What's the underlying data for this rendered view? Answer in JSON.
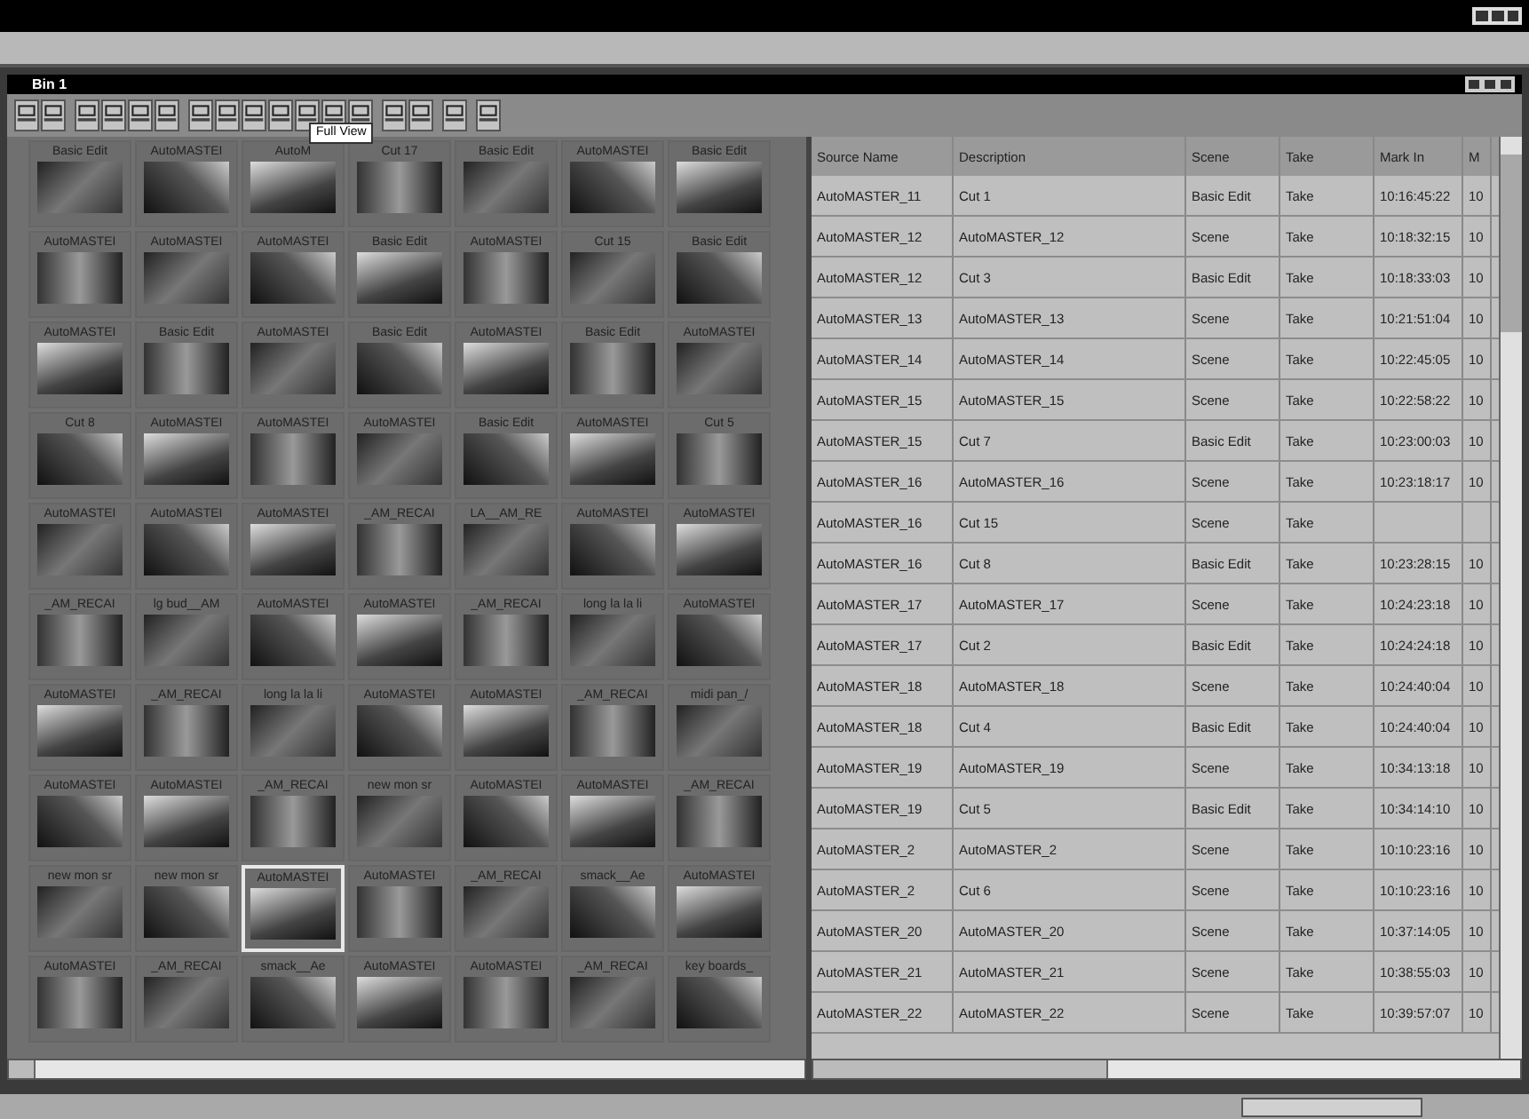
{
  "bin_window": {
    "title": "Bin 1"
  },
  "toolbar": {
    "tooltip": "Full View"
  },
  "frames": [
    [
      {
        "label": "Basic Edit",
        "selected": false
      },
      {
        "label": "AutoMASTEI",
        "selected": false
      },
      {
        "label": "AutoM",
        "selected": false
      },
      {
        "label": "Cut 17",
        "selected": false
      },
      {
        "label": "Basic Edit",
        "selected": false
      },
      {
        "label": "AutoMASTEI",
        "selected": false
      },
      {
        "label": "Basic Edit",
        "selected": false
      }
    ],
    [
      {
        "label": "AutoMASTEI",
        "selected": false
      },
      {
        "label": "AutoMASTEI",
        "selected": false
      },
      {
        "label": "AutoMASTEI",
        "selected": false
      },
      {
        "label": "Basic Edit",
        "selected": false
      },
      {
        "label": "AutoMASTEI",
        "selected": false
      },
      {
        "label": "Cut 15",
        "selected": false
      },
      {
        "label": "Basic Edit",
        "selected": false
      }
    ],
    [
      {
        "label": "AutoMASTEI",
        "selected": false
      },
      {
        "label": "Basic Edit",
        "selected": false
      },
      {
        "label": "AutoMASTEI",
        "selected": false
      },
      {
        "label": "Basic Edit",
        "selected": false
      },
      {
        "label": "AutoMASTEI",
        "selected": false
      },
      {
        "label": "Basic Edit",
        "selected": false
      },
      {
        "label": "AutoMASTEI",
        "selected": false
      }
    ],
    [
      {
        "label": "Cut 8",
        "selected": false
      },
      {
        "label": "AutoMASTEI",
        "selected": false
      },
      {
        "label": "AutoMASTEI",
        "selected": false
      },
      {
        "label": "AutoMASTEI",
        "selected": false
      },
      {
        "label": "Basic Edit",
        "selected": false
      },
      {
        "label": "AutoMASTEI",
        "selected": false
      },
      {
        "label": "Cut 5",
        "selected": false
      }
    ],
    [
      {
        "label": "AutoMASTEI",
        "selected": false
      },
      {
        "label": "AutoMASTEI",
        "selected": false
      },
      {
        "label": "AutoMASTEI",
        "selected": false
      },
      {
        "label": "_AM_RECAI",
        "selected": false
      },
      {
        "label": "LA__AM_RE",
        "selected": false
      },
      {
        "label": "AutoMASTEI",
        "selected": false
      },
      {
        "label": "AutoMASTEI",
        "selected": false
      }
    ],
    [
      {
        "label": "_AM_RECAI",
        "selected": false
      },
      {
        "label": "lg bud__AM",
        "selected": false
      },
      {
        "label": "AutoMASTEI",
        "selected": false
      },
      {
        "label": "AutoMASTEI",
        "selected": false
      },
      {
        "label": "_AM_RECAI",
        "selected": false
      },
      {
        "label": "long la la li",
        "selected": false
      },
      {
        "label": "AutoMASTEI",
        "selected": false
      }
    ],
    [
      {
        "label": "AutoMASTEI",
        "selected": false
      },
      {
        "label": "_AM_RECAI",
        "selected": false
      },
      {
        "label": "long la la li",
        "selected": false
      },
      {
        "label": "AutoMASTEI",
        "selected": false
      },
      {
        "label": "AutoMASTEI",
        "selected": false
      },
      {
        "label": "_AM_RECAI",
        "selected": false
      },
      {
        "label": "midi pan_/",
        "selected": false
      }
    ],
    [
      {
        "label": "AutoMASTEI",
        "selected": false
      },
      {
        "label": "AutoMASTEI",
        "selected": false
      },
      {
        "label": "_AM_RECAI",
        "selected": false
      },
      {
        "label": "new mon sr",
        "selected": false
      },
      {
        "label": "AutoMASTEI",
        "selected": false
      },
      {
        "label": "AutoMASTEI",
        "selected": false
      },
      {
        "label": "_AM_RECAI",
        "selected": false
      }
    ],
    [
      {
        "label": "new mon sr",
        "selected": false
      },
      {
        "label": "new mon sr",
        "selected": false
      },
      {
        "label": "AutoMASTEI",
        "selected": true
      },
      {
        "label": "AutoMASTEI",
        "selected": false
      },
      {
        "label": "_AM_RECAI",
        "selected": false
      },
      {
        "label": "smack__Ae",
        "selected": false
      },
      {
        "label": "AutoMASTEI",
        "selected": false
      }
    ],
    [
      {
        "label": "AutoMASTEI",
        "selected": false
      },
      {
        "label": "_AM_RECAI",
        "selected": false
      },
      {
        "label": "smack__Ae",
        "selected": false
      },
      {
        "label": "AutoMASTEI",
        "selected": false
      },
      {
        "label": "AutoMASTEI",
        "selected": false
      },
      {
        "label": "_AM_RECAI",
        "selected": false
      },
      {
        "label": "key boards_",
        "selected": false
      }
    ]
  ],
  "table": {
    "columns": [
      "Source Name",
      "Description",
      "Scene",
      "Take",
      "Mark In",
      "M"
    ],
    "rows": [
      [
        "AutoMASTER_11",
        "Cut 1",
        "Basic Edit",
        "Take",
        "10:16:45:22",
        "10"
      ],
      [
        "AutoMASTER_12",
        "AutoMASTER_12",
        "Scene",
        "Take",
        "10:18:32:15",
        "10"
      ],
      [
        "AutoMASTER_12",
        "Cut 3",
        "Basic Edit",
        "Take",
        "10:18:33:03",
        "10"
      ],
      [
        "AutoMASTER_13",
        "AutoMASTER_13",
        "Scene",
        "Take",
        "10:21:51:04",
        "10"
      ],
      [
        "AutoMASTER_14",
        "AutoMASTER_14",
        "Scene",
        "Take",
        "10:22:45:05",
        "10"
      ],
      [
        "AutoMASTER_15",
        "AutoMASTER_15",
        "Scene",
        "Take",
        "10:22:58:22",
        "10"
      ],
      [
        "AutoMASTER_15",
        "Cut 7",
        "Basic Edit",
        "Take",
        "10:23:00:03",
        "10"
      ],
      [
        "AutoMASTER_16",
        "AutoMASTER_16",
        "Scene",
        "Take",
        "10:23:18:17",
        "10"
      ],
      [
        "AutoMASTER_16",
        "Cut 15",
        "Scene",
        "Take",
        "",
        ""
      ],
      [
        "AutoMASTER_16",
        "Cut 8",
        "Basic Edit",
        "Take",
        "10:23:28:15",
        "10"
      ],
      [
        "AutoMASTER_17",
        "AutoMASTER_17",
        "Scene",
        "Take",
        "10:24:23:18",
        "10"
      ],
      [
        "AutoMASTER_17",
        "Cut 2",
        "Basic Edit",
        "Take",
        "10:24:24:18",
        "10"
      ],
      [
        "AutoMASTER_18",
        "AutoMASTER_18",
        "Scene",
        "Take",
        "10:24:40:04",
        "10"
      ],
      [
        "AutoMASTER_18",
        "Cut 4",
        "Basic Edit",
        "Take",
        "10:24:40:04",
        "10"
      ],
      [
        "AutoMASTER_19",
        "AutoMASTER_19",
        "Scene",
        "Take",
        "10:34:13:18",
        "10"
      ],
      [
        "AutoMASTER_19",
        "Cut 5",
        "Basic Edit",
        "Take",
        "10:34:14:10",
        "10"
      ],
      [
        "AutoMASTER_2",
        "AutoMASTER_2",
        "Scene",
        "Take",
        "10:10:23:16",
        "10"
      ],
      [
        "AutoMASTER_2",
        "Cut 6",
        "Scene",
        "Take",
        "10:10:23:16",
        "10"
      ],
      [
        "AutoMASTER_20",
        "AutoMASTER_20",
        "Scene",
        "Take",
        "10:37:14:05",
        "10"
      ],
      [
        "AutoMASTER_21",
        "AutoMASTER_21",
        "Scene",
        "Take",
        "10:38:55:03",
        "10"
      ],
      [
        "AutoMASTER_22",
        "AutoMASTER_22",
        "Scene",
        "Take",
        "10:39:57:07",
        "10"
      ]
    ]
  }
}
